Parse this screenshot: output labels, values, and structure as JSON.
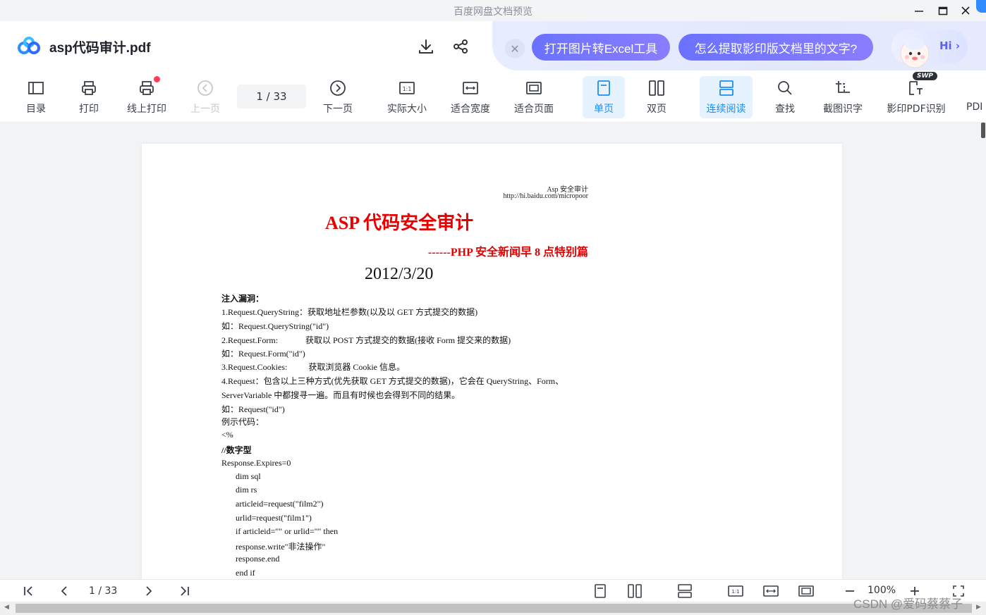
{
  "window": {
    "title": "百度网盘文档预览",
    "minimize_icon": "minimize-icon",
    "maximize_icon": "maximize-icon",
    "close_icon": "close-icon"
  },
  "header": {
    "doc_name": "asp代码审计.pdf",
    "promo": {
      "pill1": "打开图片转Excel工具",
      "pill2": "怎么提取影印版文档里的文字?",
      "hi": "Hi ›"
    }
  },
  "toolbar": {
    "catalog": "目录",
    "print": "打印",
    "online_print": "线上打印",
    "prev_page": "上一页",
    "page_indicator": "1  / 33",
    "next_page": "下一页",
    "actual_size": "实际大小",
    "fit_width": "适合宽度",
    "fit_page": "适合页面",
    "single_page": "单页",
    "double_page": "双页",
    "continuous": "连续阅读",
    "find": "查找",
    "screenshot_ocr": "截图识字",
    "scan_pdf_ocr": "影印PDF识别",
    "pdf_more": "PDI",
    "swp_badge": "SWP",
    "accent": "#1e8cf0"
  },
  "document": {
    "header_line1": "Asp 安全审计",
    "header_line2": "http://hi.baidu.com/micropoor",
    "title": "ASP 代码安全审计",
    "subtitle": "------PHP 安全新闻早 8 点特别篇",
    "date": "2012/3/20",
    "lines": [
      "注入漏洞：",
      "1.Request.QueryString：获取地址栏参数(以及以 GET 方式提交的数据)",
      "如：Request.QueryString(\"id\")",
      "2.Request.Form:             获取以 POST 方式提交的数据(接收 Form 提交来的数据)",
      "如：Request.Form(\"id\")",
      "3.Request.Cookies:          获取浏览器 Cookie 信息。",
      "4.Request：包含以上三种方式(优先获取 GET 方式提交的数据)，它会在 QueryString、Form、",
      "ServerVariable 中都搜寻一遍。而且有时候也会得到不同的结果。",
      "如：Request(\"id\")",
      "例示代码：",
      "<%",
      "//数字型",
      "Response.Expires=0",
      "dim sql",
      "dim rs",
      "articleid=request(\"film2\")",
      "urlid=request(\"film1\")",
      "if articleid=\"\" or urlid=\"\" then",
      "response.write\"非法操作\"",
      "response.end",
      "end if"
    ]
  },
  "bottombar": {
    "page_indicator": "1  / 33",
    "zoom": "100%"
  },
  "watermark": "CSDN @爱码蔡蔡子"
}
